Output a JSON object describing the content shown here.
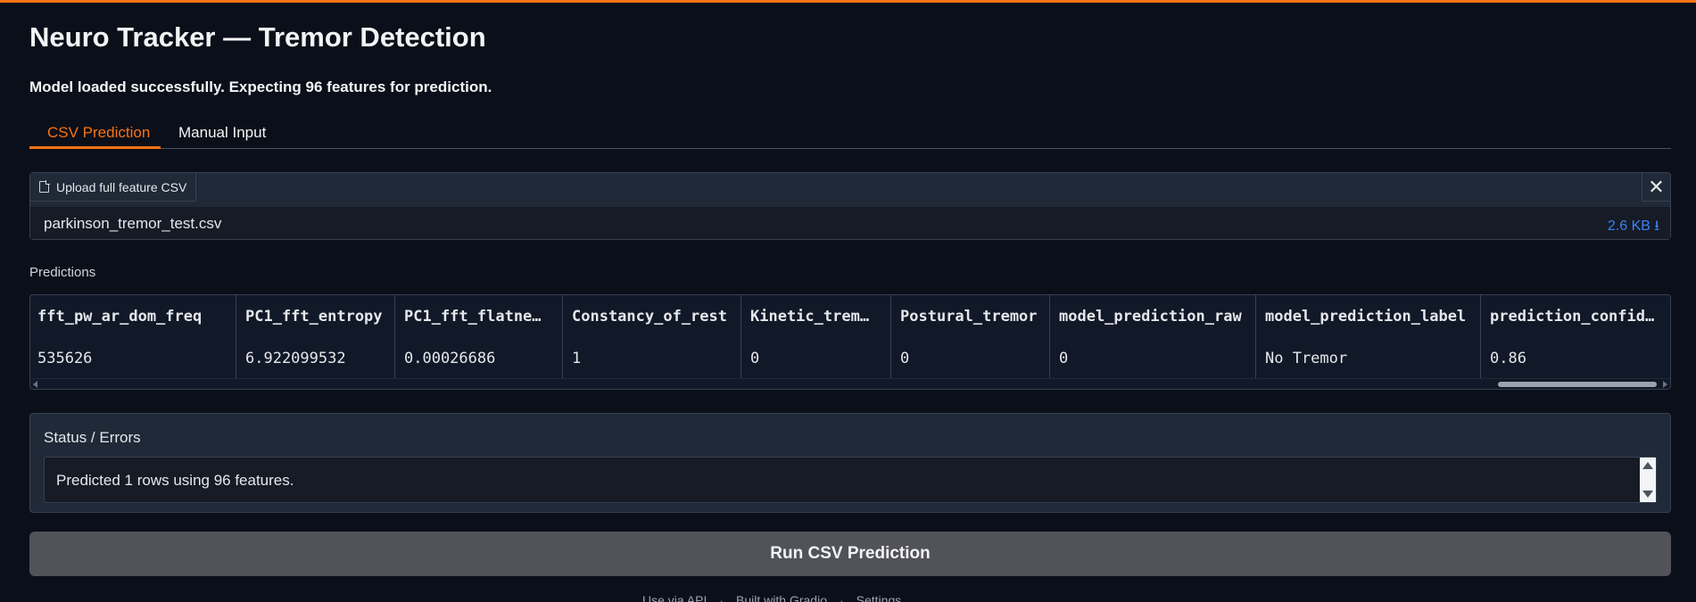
{
  "app": {
    "title": "Neuro Tracker — Tremor Detection",
    "status_message": "Model loaded successfully. Expecting 96 features for prediction.",
    "accent_color": "#f97316"
  },
  "tabs": [
    {
      "label": "CSV Prediction",
      "active": true
    },
    {
      "label": "Manual Input",
      "active": false
    }
  ],
  "upload": {
    "label": "Upload full feature CSV",
    "file_name": "parkinson_tremor_test.csv",
    "file_size": "2.6 KB ⭳",
    "icons": {
      "file": "file-icon",
      "close": "close-icon"
    }
  },
  "predictions": {
    "label": "Predictions",
    "columns": [
      "fft_pw_ar_dom_freq",
      "PC1_fft_entropy",
      "PC1_fft_flatne…",
      "Constancy_of_rest",
      "Kinetic_trem…",
      "Postural_tremor",
      "model_prediction_raw",
      "model_prediction_label",
      "prediction_confiden…"
    ],
    "rows": [
      [
        "535626",
        "6.922099532",
        "0.00026686",
        "1",
        "0",
        "0",
        "0",
        "No Tremor",
        "0.86"
      ]
    ]
  },
  "status": {
    "label": "Status / Errors",
    "text": "Predicted 1 rows using 96 features."
  },
  "run_button": {
    "label": "Run CSV Prediction"
  },
  "footer": {
    "items": [
      "Use via API",
      "Built with Gradio",
      "Settings"
    ]
  }
}
